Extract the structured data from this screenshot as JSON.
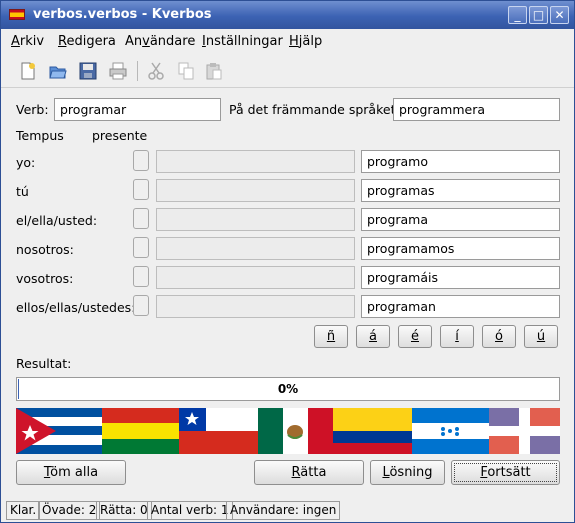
{
  "window": {
    "title": "verbos.verbos - Kverbos",
    "buttons": {
      "minimize": "_",
      "maximize": "□",
      "close": "✕"
    }
  },
  "menu": [
    {
      "pre": "",
      "u": "A",
      "post": "rkiv"
    },
    {
      "pre": "",
      "u": "R",
      "post": "edigera"
    },
    {
      "pre": "An",
      "u": "v",
      "post": "ändare"
    },
    {
      "pre": "",
      "u": "I",
      "post": "nställningar"
    },
    {
      "pre": "",
      "u": "H",
      "post": "jälp"
    }
  ],
  "toolbar": [
    "new-icon",
    "open-icon",
    "save-icon",
    "print-icon",
    "cut-icon",
    "copy-icon",
    "paste-icon"
  ],
  "form": {
    "verb_label": "Verb:",
    "verb_value": "programar",
    "foreign_label": "På det främmande språket:",
    "foreign_value": "programmera",
    "tense_label": "Tempus",
    "tense_value": "presente"
  },
  "rows": [
    {
      "pronoun": "yo:",
      "answer": "",
      "solution": "programo"
    },
    {
      "pronoun": "tú",
      "answer": "",
      "solution": "programas"
    },
    {
      "pronoun": "el/ella/usted:",
      "answer": "",
      "solution": "programa"
    },
    {
      "pronoun": "nosotros:",
      "answer": "",
      "solution": "programamos"
    },
    {
      "pronoun": "vosotros:",
      "answer": "",
      "solution": "programáis"
    },
    {
      "pronoun": "ellos/ellas/ustedes:",
      "answer": "",
      "solution": "programan"
    }
  ],
  "special_chars": [
    "ñ",
    "á",
    "é",
    "í",
    "ó",
    "ú"
  ],
  "result": {
    "label": "Resultat:",
    "progress_text": "0%",
    "progress_fraction": 0
  },
  "flags": [
    "cuba",
    "bolivia",
    "chile",
    "mexico",
    "colombia",
    "honduras",
    "dominican-republic"
  ],
  "buttons": {
    "clear": {
      "pre": "",
      "u": "T",
      "post": "öm alla"
    },
    "correct": {
      "pre": "",
      "u": "R",
      "post": "ätta"
    },
    "solution": {
      "pre": "",
      "u": "L",
      "post": "ösning"
    },
    "continue": {
      "pre": "",
      "u": "F",
      "post": "ortsätt"
    }
  },
  "status": [
    "Klar.",
    "Övade: 2",
    "Rätta: 0",
    "Antal verb: 1",
    "Användare: ingen"
  ],
  "colors": {
    "titlebar": "#3c62b3",
    "progress": "#3c62b3"
  }
}
